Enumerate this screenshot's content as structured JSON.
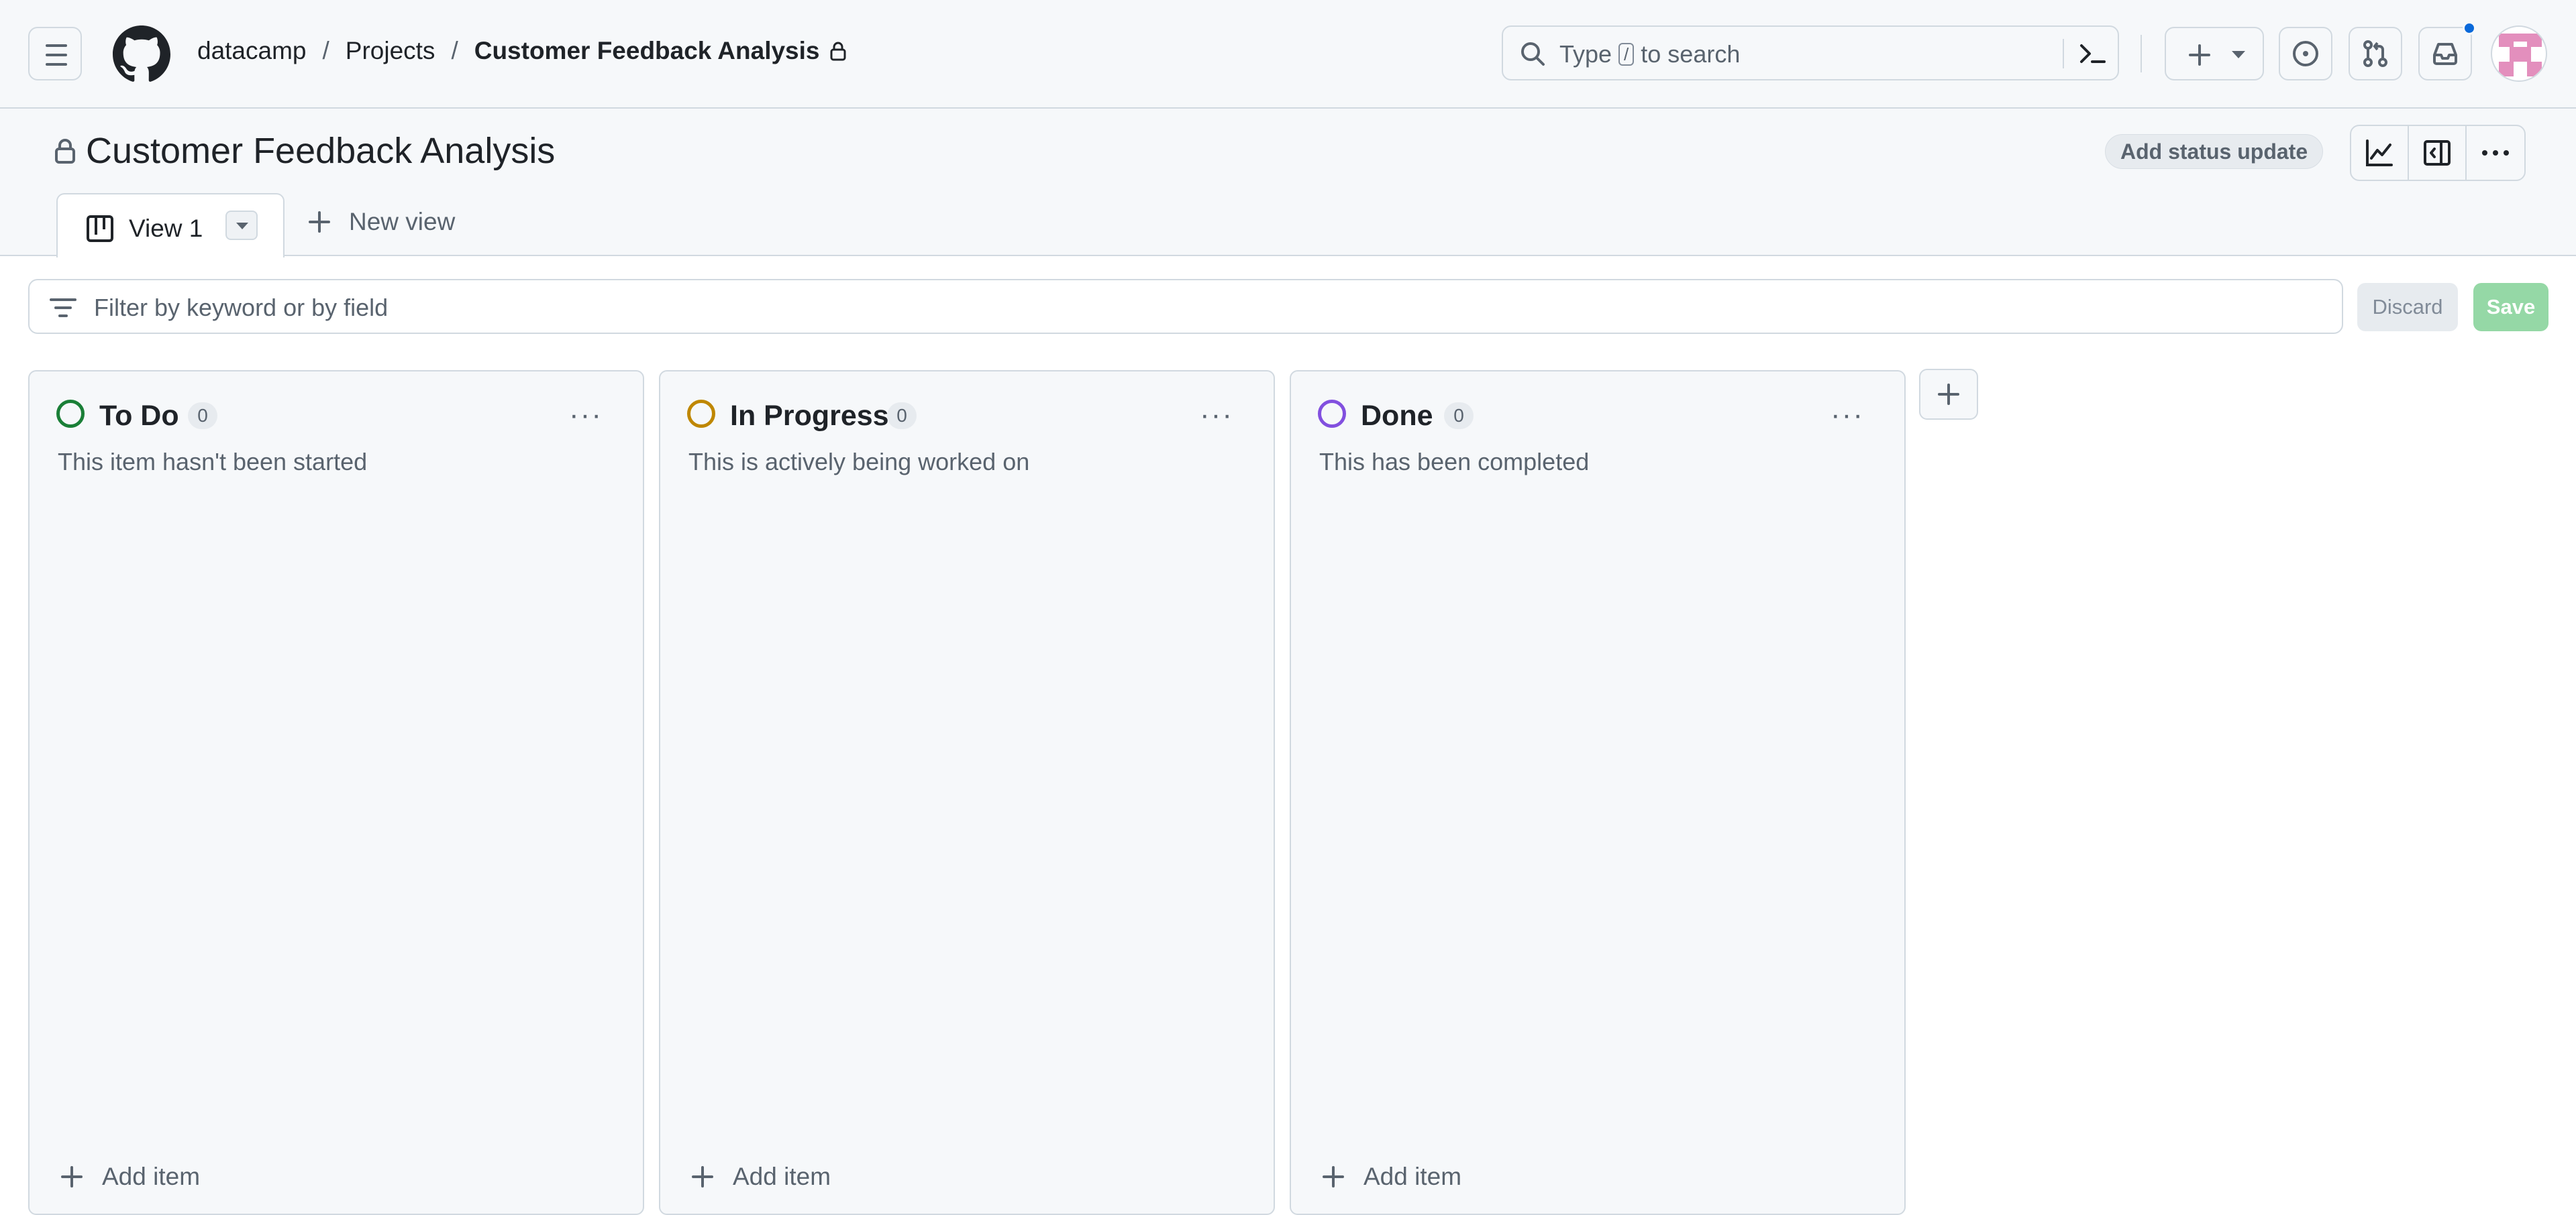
{
  "header": {
    "breadcrumb": {
      "owner": "datacamp",
      "section": "Projects",
      "current": "Customer Feedback Analysis",
      "separator": "/"
    },
    "search": {
      "placeholder_before": "Type",
      "shortcut_key": "/",
      "placeholder_after": "to search"
    },
    "notification_dot_color": "#0969da"
  },
  "project": {
    "title": "Customer Feedback Analysis",
    "status_update_label": "Add status update"
  },
  "tabs": {
    "active_label": "View 1",
    "new_view_label": "New view"
  },
  "filter": {
    "placeholder": "Filter by keyword or by field",
    "discard_label": "Discard",
    "save_label": "Save"
  },
  "columns": [
    {
      "name": "To Do",
      "count": "0",
      "description": "This item hasn't been started",
      "color": "#1a7f37",
      "add_label": "Add item"
    },
    {
      "name": "In Progress",
      "count": "0",
      "description": "This is actively being worked on",
      "color": "#bf8700",
      "add_label": "Add item"
    },
    {
      "name": "Done",
      "count": "0",
      "description": "This has been completed",
      "color": "#8250df",
      "add_label": "Add item"
    }
  ],
  "icons": [
    "hamburger-icon",
    "github-logo-icon",
    "lock-icon",
    "search-icon",
    "terminal-icon",
    "plus-icon",
    "chevron-down-icon",
    "issues-icon",
    "pull-request-icon",
    "inbox-icon",
    "chart-icon",
    "sidebar-icon",
    "kebab-icon",
    "board-icon",
    "filter-icon"
  ]
}
